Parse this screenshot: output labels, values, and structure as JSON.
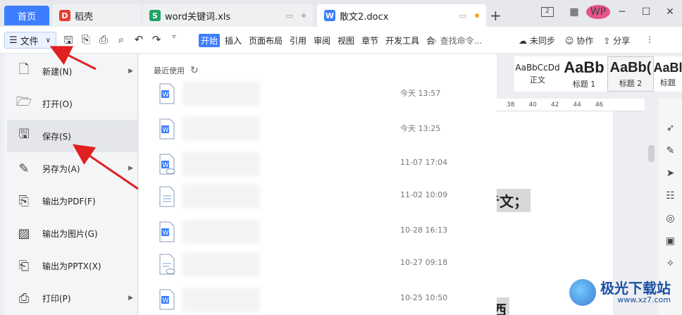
{
  "tabs": {
    "home": "首页",
    "items": [
      {
        "label": "稻壳",
        "icon_color": "#e63d2f",
        "icon_glyph": "D"
      },
      {
        "label": "word关键词.xls",
        "icon_color": "#1fa463",
        "icon_glyph": "S"
      },
      {
        "label": "散文2.docx",
        "icon_color": "#3d7eff",
        "icon_glyph": "W"
      }
    ],
    "add": "+"
  },
  "window": {
    "user_initials": "WP",
    "layout_icon": "2",
    "grid_icon": "▦",
    "minimize": "─",
    "maximize": "☐",
    "close": "✕"
  },
  "toolbar": {
    "file_label": "文件",
    "ribbon_tabs": [
      "开始",
      "插入",
      "页面布局",
      "引用",
      "审阅",
      "视图",
      "章节",
      "开发工具",
      "会"
    ],
    "search_placeholder": "查找命令...",
    "sync": "未同步",
    "collab": "协作",
    "share": "分享"
  },
  "styles": [
    {
      "preview": "AaBbCcDd",
      "name": "正文"
    },
    {
      "preview": "AaBb",
      "name": "标题 1"
    },
    {
      "preview": "AaBb(",
      "name": "标题 2"
    },
    {
      "preview": "AaBl",
      "name": "标题"
    }
  ],
  "ruler": [
    "38",
    "40",
    "42",
    "44",
    "46"
  ],
  "document": {
    "line1": "亍文；",
    "line2": "到西"
  },
  "file_menu": {
    "items": [
      {
        "label": "新建(N)",
        "icon": "new-file-icon",
        "has_submenu": true
      },
      {
        "label": "打开(O)",
        "icon": "folder-open-icon",
        "has_submenu": false
      },
      {
        "label": "保存(S)",
        "icon": "save-icon",
        "has_submenu": false
      },
      {
        "label": "另存为(A)",
        "icon": "save-as-icon",
        "has_submenu": true
      },
      {
        "label": "输出为PDF(F)",
        "icon": "export-pdf-icon",
        "has_submenu": false
      },
      {
        "label": "输出为图片(G)",
        "icon": "export-image-icon",
        "has_submenu": false
      },
      {
        "label": "输出为PPTX(X)",
        "icon": "export-pptx-icon",
        "has_submenu": false
      },
      {
        "label": "打印(P)",
        "icon": "print-icon",
        "has_submenu": true
      }
    ]
  },
  "recent": {
    "title": "最近使用",
    "items": [
      {
        "time": "今天  13:57",
        "type": "word"
      },
      {
        "time": "今天  13:25",
        "type": "word"
      },
      {
        "time": "11-07 17:04",
        "type": "word-cloud"
      },
      {
        "time": "11-02 10:09",
        "type": "text"
      },
      {
        "time": "10-28 16:13",
        "type": "word"
      },
      {
        "time": "10-27 09:18",
        "type": "text-cloud"
      },
      {
        "time": "10-25 10:50",
        "type": "word"
      }
    ]
  },
  "watermark": {
    "text": "极光下载站",
    "url": "www.xz7.com"
  },
  "colors": {
    "accent": "#3d7eff",
    "arrow": "#e02020"
  }
}
